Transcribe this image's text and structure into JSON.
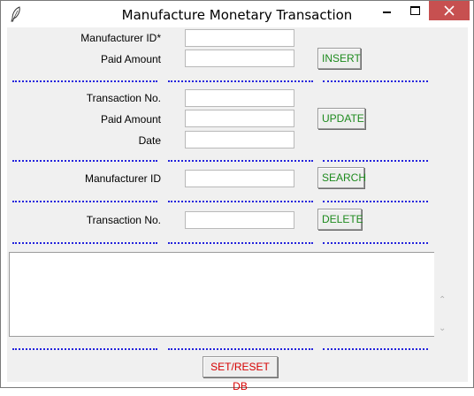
{
  "window": {
    "title": "Manufacture Monetary Transaction"
  },
  "insert_section": {
    "manufacturer_id_label": "Manufacturer ID*",
    "paid_amount_label": "Paid Amount",
    "manufacturer_id_value": "",
    "paid_amount_value": "",
    "button_label": "INSERT"
  },
  "update_section": {
    "transaction_no_label": "Transaction No.",
    "paid_amount_label": "Paid Amount",
    "date_label": "Date",
    "transaction_no_value": "",
    "paid_amount_value": "",
    "date_value": "",
    "button_label": "UPDATE"
  },
  "search_section": {
    "manufacturer_id_label": "Manufacturer ID",
    "manufacturer_id_value": "",
    "button_label": "SEARCH"
  },
  "delete_section": {
    "transaction_no_label": "Transaction No.",
    "transaction_no_value": "",
    "button_label": "DELETE"
  },
  "output": {
    "text": ""
  },
  "footer": {
    "button_label": "SET/RESET DB"
  },
  "colors": {
    "action_button_text": "#1d8a1d",
    "reset_button_text": "#d60000",
    "separator": "#2222dd",
    "close_button": "#c75050"
  },
  "icons": {
    "app": "feather-icon",
    "minimize": "minimize-icon",
    "maximize": "maximize-icon",
    "close": "close-icon",
    "scroll_up": "chevron-up-icon",
    "scroll_down": "chevron-down-icon"
  }
}
